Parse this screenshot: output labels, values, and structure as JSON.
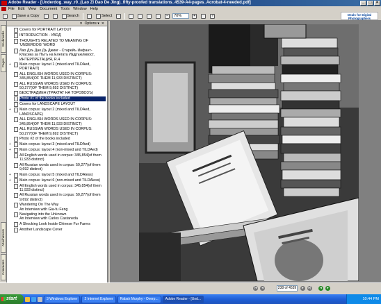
{
  "window": {
    "title": "Adobe Reader - [Underdog_way_r0_(Lao Zi Dao De Jing)_fifty-proofed translations_4539-A4-pages_Acrobat-4-needed.pdf]"
  },
  "menu": [
    "File",
    "Edit",
    "View",
    "Document",
    "Tools",
    "Window",
    "Help"
  ],
  "toolbar": {
    "save_copy": "Save a Copy",
    "search": "Search",
    "select": "Select",
    "zoom": "70%"
  },
  "brand": {
    "line1": "Deals for Digital",
    "line2": "Photographers"
  },
  "sidetabs": {
    "bookmarks": "Bookmarks",
    "pages": "Pages",
    "attachments": "Attachments",
    "comments": "Comments"
  },
  "panel": {
    "options": "Options"
  },
  "bookmarks": [
    {
      "label": "Covers for PORTRAIT LAYOUT",
      "exp": "",
      "sel": false
    },
    {
      "label": "INTRODUCTION - УВОД",
      "exp": "",
      "sel": false
    },
    {
      "label": "THOUGHTS RELATED TO MEANING OF 'UNDERDOG' WORD",
      "exp": "",
      "sel": false
    },
    {
      "label": "Лао Дзъ Дао Дъ Джинг - Старейъ Инфант-Класика за Пътъ на Елегата Издръжливост, ИНТЕРПРЕТАЦИЯ, R.4",
      "exp": "",
      "sel": false
    },
    {
      "label": "Main corpus: layout 1 (mixed and TILDAed, PORTRAIT)",
      "exp": "+",
      "sel": false
    },
    {
      "label": "ALL ENGLISH WORDS USED IN CORPUS: 345,854(OF THEM 11,933 DISTINCT)",
      "exp": "",
      "sel": false
    },
    {
      "label": "ALL RUSSIAN WORDS USED IN CORPUS: 50,277(OF THEM 9,692 DISTINCT)",
      "exp": "",
      "sel": false
    },
    {
      "label": "БЕЗСТРАДИЕН (ТРАКТАТ НА ТОРОВОЗЪ)",
      "exp": "",
      "sel": false
    },
    {
      "label": "Photo #1 of the books included",
      "exp": "",
      "sel": true
    },
    {
      "label": "Covers for LANDSCAPE LAYOUT",
      "exp": "",
      "sel": false
    },
    {
      "label": "Main corpus: layout 2 (mixed and TILDAed, LANDSCAPE)",
      "exp": "+",
      "sel": false
    },
    {
      "label": "ALL ENGLISH WORDS USED IN CORPUS: 345,854(OF THEM 11,933 DISTINCT)",
      "exp": "",
      "sel": false
    },
    {
      "label": "ALL RUSSIAN WORDS USED IN CORPUS: 50,277(OF THEM 9,692 DISTINCT)",
      "exp": "",
      "sel": false
    },
    {
      "label": "Photo #2 of the books included",
      "exp": "",
      "sel": false
    },
    {
      "label": "Main corpus: layout 3 (mixed and TILDAed)",
      "exp": "+",
      "sel": false
    },
    {
      "label": "Main corpus: layout 4 (non-mixed and TILDAed)",
      "exp": "+",
      "sel": false
    },
    {
      "label": "All English words used in corpus: 345,854(of them 11,933 distinct)",
      "exp": "",
      "sel": false
    },
    {
      "label": "All Russian words used in corpus: 50,277(of them 9,692 distinct)",
      "exp": "",
      "sel": false
    },
    {
      "label": "Main corpus: layout 5 (mixed and TILDAless)",
      "exp": "+",
      "sel": false
    },
    {
      "label": "Main corpus: layout 6 (non-mixed and TILDAless)",
      "exp": "+",
      "sel": false
    },
    {
      "label": "All English words used in corpus: 345,854(of them 11,933 distinct)",
      "exp": "",
      "sel": false
    },
    {
      "label": "All Russian words used in corpus: 50,277(of them 9,692 distinct)",
      "exp": "",
      "sel": false
    },
    {
      "label": "Wandering On The Way\nAn Interview with Gia-fu Feng",
      "exp": "",
      "sel": false
    },
    {
      "label": "Navigating into the Unknown\nAn Interview with Carlos Castaneda",
      "exp": "",
      "sel": false
    },
    {
      "label": "A Shocking Look Inside Chinese Fur Farms",
      "exp": "",
      "sel": false
    },
    {
      "label": "Another Landscape Cover",
      "exp": "",
      "sel": false
    }
  ],
  "navbar": {
    "page_indicator": "238 of 4539"
  },
  "taskbar": {
    "start": "start",
    "tasks": [
      "3 Windows Explorer",
      "2 Internet Explorer",
      "Rabah Murphy - Overp...",
      "Adobe Reader - [Und..."
    ],
    "clock": "10:44 PM"
  }
}
